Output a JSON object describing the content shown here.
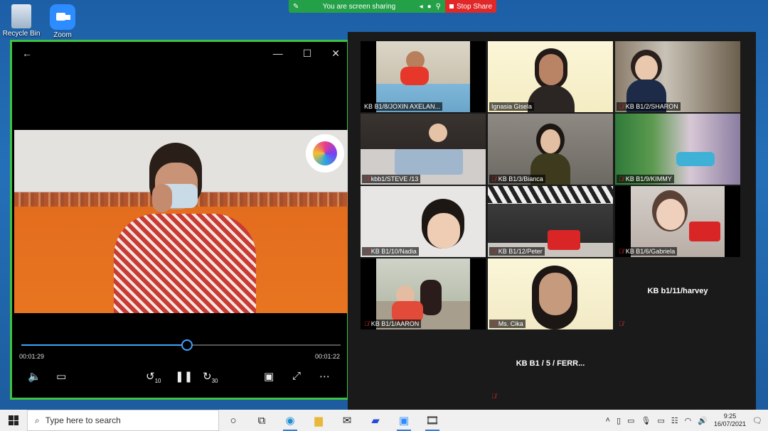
{
  "desktop": {
    "icons": [
      {
        "label": "Recycle Bin",
        "icon": "recycle-bin-icon"
      },
      {
        "label": "Zoom",
        "icon": "zoom-app-icon"
      }
    ]
  },
  "share_bar": {
    "status": "You are screen sharing",
    "stop_label": "Stop Share",
    "colors": {
      "status": "#24a148",
      "stop": "#e02828"
    }
  },
  "player": {
    "elapsed": "00:01:29",
    "remaining": "00:01:22",
    "progress": 0.52,
    "controls": [
      "volume-icon",
      "subtitles-icon",
      "rewind-10-icon",
      "pause-icon",
      "forward-30-icon",
      "mini-view-icon",
      "fullscreen-icon",
      "more-icon"
    ],
    "skip_back_label": "10",
    "skip_fwd_label": "30",
    "accent": "#3fa4ff"
  },
  "gallery": {
    "tiles": [
      {
        "name": "KB B1/8/JOXIN AXELAN...",
        "muted": false,
        "video": true
      },
      {
        "name": "Ignasia Gisela",
        "muted": false,
        "video": true,
        "active": true
      },
      {
        "name": "KB B1/2/SHARON",
        "muted": true,
        "video": true
      },
      {
        "name": "kbb1/STEVE /13",
        "muted": true,
        "video": true
      },
      {
        "name": "KB B1/3/Bianca",
        "muted": true,
        "video": true
      },
      {
        "name": "KB B1/9/KIMMY",
        "muted": true,
        "video": true
      },
      {
        "name": "KB B1/10/Nadia",
        "muted": true,
        "video": true
      },
      {
        "name": "KB B1/12/Peter",
        "muted": true,
        "video": true
      },
      {
        "name": "KB B1/6/Gabriela",
        "muted": true,
        "video": true
      },
      {
        "name": "KB B1/1/AARON",
        "muted": true,
        "video": true
      },
      {
        "name": "Ms. Cika",
        "muted": true,
        "video": true
      },
      {
        "name": "KB b1/11/harvey",
        "muted": true,
        "video": false
      },
      {
        "name": "KB B1 / 5 / FERR...",
        "muted": true,
        "video": false
      }
    ]
  },
  "taskbar": {
    "search_placeholder": "Type here to search",
    "apps": [
      "task-view-icon",
      "edge-icon",
      "file-explorer-icon",
      "mail-icon",
      "app-icon",
      "zoom-icon",
      "media-player-icon"
    ],
    "time": "9:25",
    "date": "16/07/2021"
  }
}
